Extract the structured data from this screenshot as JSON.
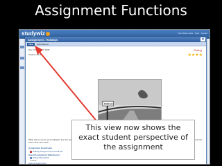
{
  "slide": {
    "title": "Assignment Functions"
  },
  "app": {
    "logo_text": "studywiz",
    "header_links": "Your Name Here  ·  Help  ·  Logout"
  },
  "modal": {
    "title": "Assignment - Holidays",
    "close_glyph": "✕",
    "tabs": [
      {
        "label": "View"
      },
      {
        "label": "Submissions"
      }
    ],
    "due_text": "Due: October 17, 2008",
    "teacher_text": "Teacher Admin",
    "rating_label": "Rating",
    "rating_stars": "★★★★",
    "rating_value": 4,
    "description": "What did you do for your holidays? For this assignment, tell me about what you did. I think this will be a fun assignment and I look forward to all the stories. Minimum word count 3000 words. This is due next week.",
    "photo_sign": "FINISH",
    "assignment_downloads_heading": "Assignment Downloads",
    "download_file": "Holiday Assignment Coverall.pdf",
    "saved_submissions_heading": "Saved Assignment Submission:",
    "submission_name": "Richard Meadows",
    "submission_meta": "a week",
    "submit_link": "Submit Assignment"
  },
  "callout": {
    "line1": "This view now shows the",
    "line2": "exact student perspective of",
    "line3": "the assignment"
  },
  "colors": {
    "accent": "#2d5b9b",
    "arrow": "#e23a2f",
    "stars": "#f1b400"
  }
}
